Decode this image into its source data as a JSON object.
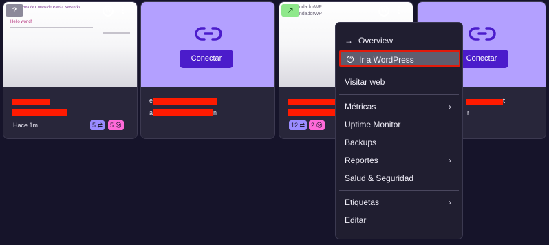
{
  "cards": [
    {
      "type": "preview",
      "help_badge": "?",
      "preview": {
        "site_title": "…rma de Cursos de Raiola Networks",
        "site_sub": "…os",
        "hello": "Hello world!"
      },
      "time": "Hace 1m",
      "badge1": "5 ⇄",
      "badge2": "5 ☹"
    },
    {
      "type": "connect",
      "connect_label": "Conectar",
      "partial_text_1": "e",
      "partial_text_2": "a",
      "partial_text_3": "n"
    },
    {
      "type": "preview-purple",
      "arrow_badge": "↗",
      "site_title": "…endadorWP",
      "site_sub": "…endadorWP",
      "badge1": "12 ⇄",
      "badge2": "2 ☹"
    },
    {
      "type": "connect",
      "connect_label": "Conectar",
      "partial_text_1": "t",
      "partial_text_2": "r"
    }
  ],
  "menu": {
    "items": [
      {
        "label": "Overview",
        "icon": "arrow-right-icon"
      },
      {
        "label": "Ir a WordPress",
        "icon": "wordpress-icon",
        "highlighted": true
      },
      {
        "label": "Visitar web"
      },
      {
        "label": "Métricas",
        "submenu": true
      },
      {
        "label": "Uptime Monitor"
      },
      {
        "label": "Backups"
      },
      {
        "label": "Reportes",
        "submenu": true
      },
      {
        "label": "Salud & Seguridad"
      },
      {
        "label": "Etiquetas",
        "submenu": true
      },
      {
        "label": "Editar"
      }
    ]
  },
  "glyphs": {
    "arrow": "→",
    "chevron": "›",
    "wp": "W",
    "help": "?"
  },
  "colors": {
    "accent": "#4b1ccb",
    "highlight_border": "#e11a0b",
    "redaction": "#ff1a00"
  }
}
